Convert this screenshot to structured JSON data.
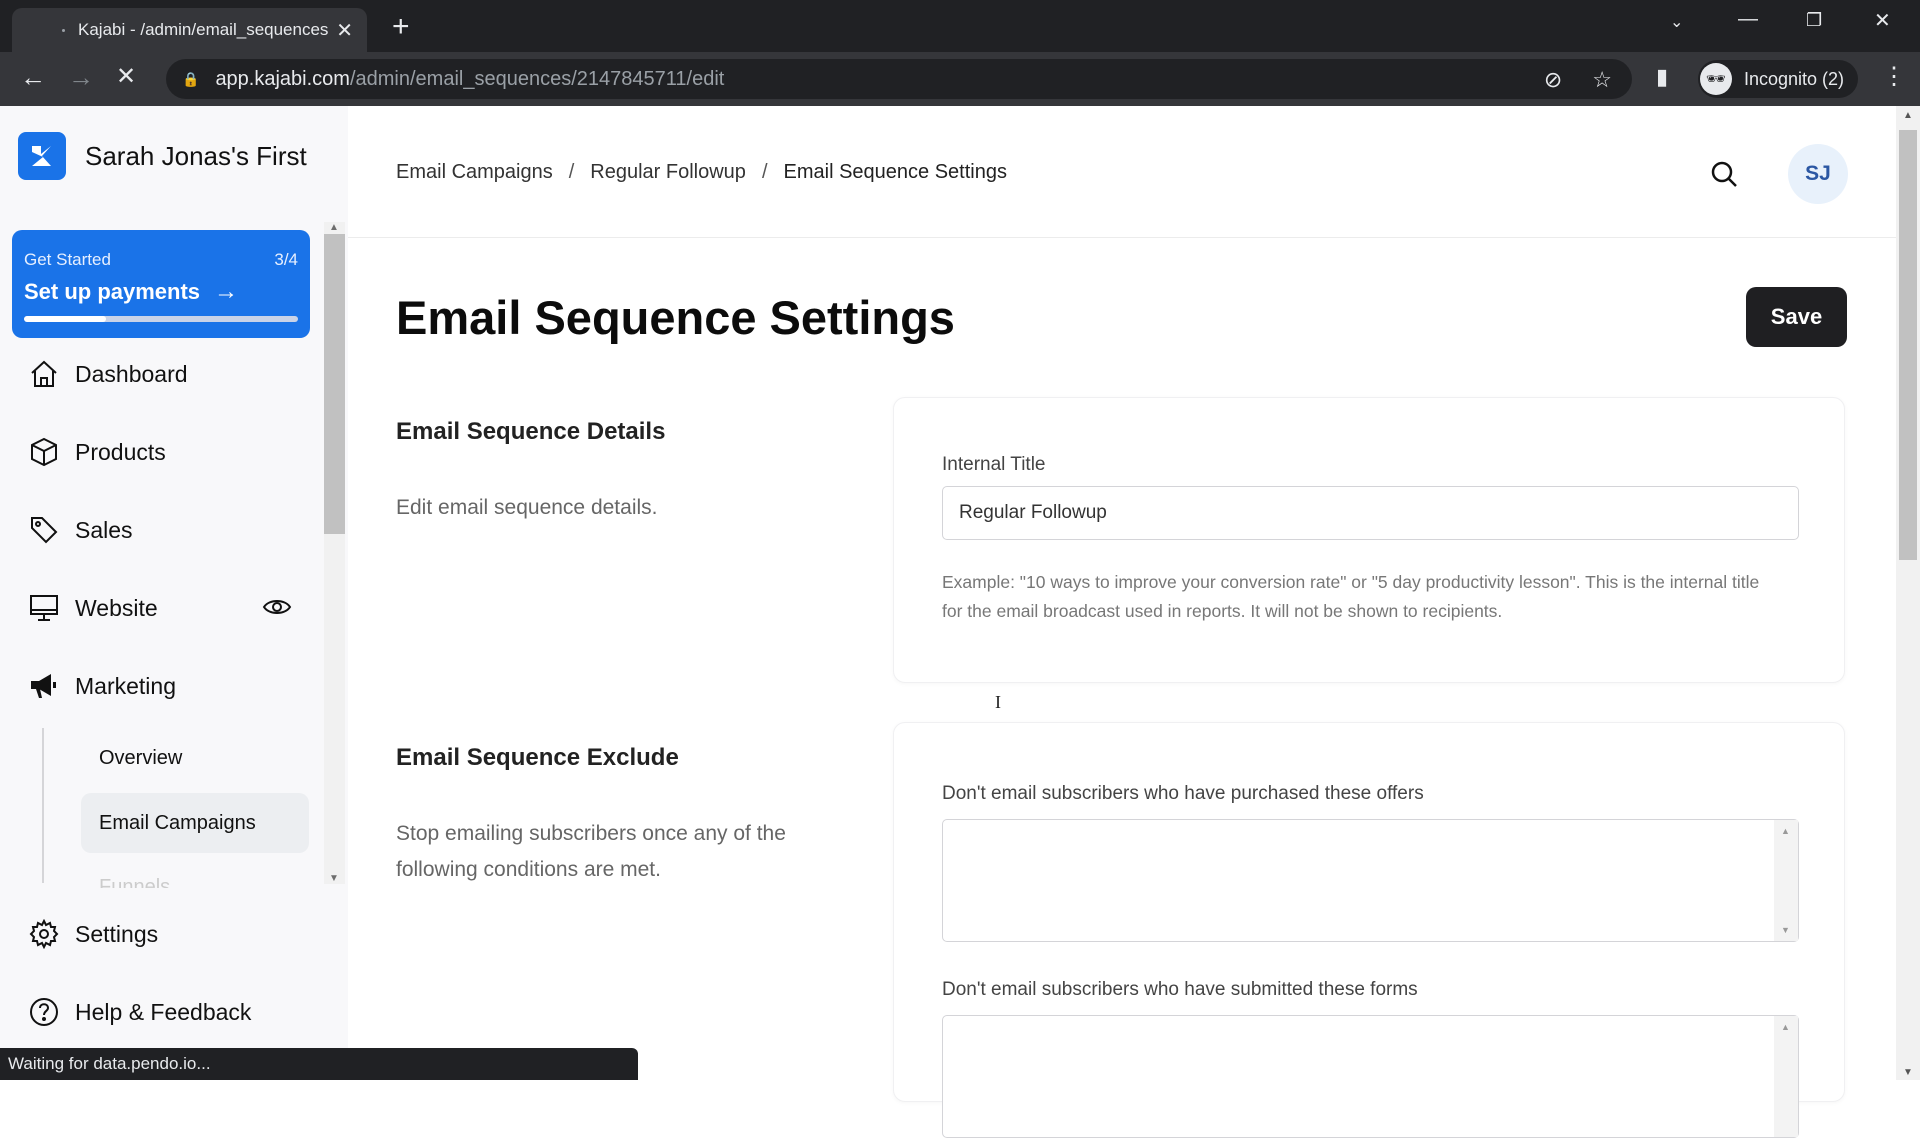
{
  "browser": {
    "tab_title": "Kajabi - /admin/email_sequences",
    "url_host": "app.kajabi.com",
    "url_path": "/admin/email_sequences/2147845711/edit",
    "profile_label": "Incognito (2)"
  },
  "sidebar": {
    "brand_name": "Sarah Jonas's First",
    "get_started": {
      "label": "Get Started",
      "step": "3/4",
      "action": "Set up payments",
      "progress_fraction": 0.3
    },
    "items": [
      {
        "label": "Dashboard",
        "icon": "home-icon"
      },
      {
        "label": "Products",
        "icon": "box-icon"
      },
      {
        "label": "Sales",
        "icon": "tag-icon"
      },
      {
        "label": "Website",
        "icon": "monitor-icon"
      },
      {
        "label": "Marketing",
        "icon": "megaphone-icon"
      }
    ],
    "marketing_sub": [
      {
        "label": "Overview",
        "active": false
      },
      {
        "label": "Email Campaigns",
        "active": true
      },
      {
        "label": "Funnels",
        "active": false
      }
    ],
    "bottom_items": [
      {
        "label": "Settings",
        "icon": "gear-icon"
      },
      {
        "label": "Help & Feedback",
        "icon": "help-icon"
      }
    ]
  },
  "header": {
    "breadcrumb": [
      "Email Campaigns",
      "Regular Followup",
      "Email Sequence Settings"
    ],
    "separator": "/",
    "avatar_initials": "SJ"
  },
  "main": {
    "title": "Email Sequence Settings",
    "save_label": "Save",
    "details": {
      "title": "Email Sequence Details",
      "description": "Edit email sequence details.",
      "internal_title_label": "Internal Title",
      "internal_title_value": "Regular Followup",
      "help_text": "Example: \"10 ways to improve your conversion rate\" or \"5 day productivity lesson\". This is the internal title for the email broadcast used in reports. It will not be shown to recipients."
    },
    "exclude": {
      "title": "Email Sequence Exclude",
      "description": "Stop emailing subscribers once any of the following conditions are met.",
      "offers_label": "Don't email subscribers who have purchased these offers",
      "forms_label": "Don't email subscribers who have submitted these forms"
    }
  },
  "status_bar": "Waiting for data.pendo.io...",
  "colors": {
    "brand": "#1a73e8",
    "save_button": "#1f1f22",
    "avatar_bg": "#e8f1fb",
    "avatar_text": "#2b57a3"
  }
}
